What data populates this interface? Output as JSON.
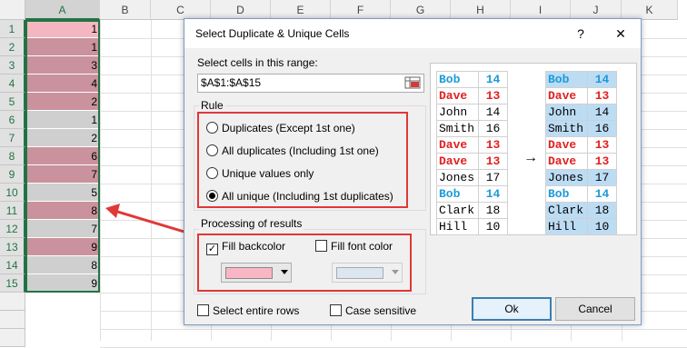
{
  "spreadsheet": {
    "columns": [
      "A",
      "B",
      "C",
      "D",
      "E",
      "F",
      "G",
      "H",
      "I",
      "J",
      "K"
    ],
    "rows": [
      {
        "num": "1",
        "value": "1",
        "highlight": "pink"
      },
      {
        "num": "2",
        "value": "1",
        "highlight": "mauve"
      },
      {
        "num": "3",
        "value": "3",
        "highlight": "mauve"
      },
      {
        "num": "4",
        "value": "4",
        "highlight": "mauve"
      },
      {
        "num": "5",
        "value": "2",
        "highlight": "mauve"
      },
      {
        "num": "6",
        "value": "1",
        "highlight": "gray"
      },
      {
        "num": "7",
        "value": "2",
        "highlight": "gray"
      },
      {
        "num": "8",
        "value": "6",
        "highlight": "mauve"
      },
      {
        "num": "9",
        "value": "7",
        "highlight": "mauve"
      },
      {
        "num": "10",
        "value": "5",
        "highlight": "gray"
      },
      {
        "num": "11",
        "value": "8",
        "highlight": "mauve"
      },
      {
        "num": "12",
        "value": "7",
        "highlight": "gray"
      },
      {
        "num": "13",
        "value": "9",
        "highlight": "mauve"
      },
      {
        "num": "14",
        "value": "8",
        "highlight": "gray"
      },
      {
        "num": "15",
        "value": "9",
        "highlight": "gray"
      }
    ],
    "colors": {
      "pink": "#f4b7c1",
      "mauve": "#c9929c",
      "gray": "#cfcfcf"
    }
  },
  "dialog": {
    "title": "Select Duplicate & Unique Cells",
    "help_label": "?",
    "close_label": "✕",
    "range_label": "Select cells in this range:",
    "range_value": "$A$1:$A$15",
    "rule_title": "Rule",
    "rules": [
      {
        "label": "Duplicates (Except 1st one)",
        "selected": false
      },
      {
        "label": "All duplicates (Including 1st one)",
        "selected": false
      },
      {
        "label": "Unique values only",
        "selected": false
      },
      {
        "label": "All unique (Including 1st duplicates)",
        "selected": true
      }
    ],
    "processing_title": "Processing of results",
    "fill_backcolor_label": "Fill backcolor",
    "fill_backcolor_checked": true,
    "fill_backcolor_color": "#f9b6c4",
    "fill_font_label": "Fill font color",
    "fill_font_checked": false,
    "fill_font_color": "#dbe6f2",
    "select_rows_label": "Select entire rows",
    "case_sensitive_label": "Case sensitive",
    "ok_label": "Ok",
    "cancel_label": "Cancel",
    "check_mark": "✓"
  },
  "preview": {
    "before": [
      {
        "name": "Bob",
        "num": "14",
        "color": "#1e9bd7"
      },
      {
        "name": "Dave",
        "num": "13",
        "color": "#e02020"
      },
      {
        "name": "John",
        "num": "14",
        "color": "#000000"
      },
      {
        "name": "Smith",
        "num": "16",
        "color": "#000000"
      },
      {
        "name": "Dave",
        "num": "13",
        "color": "#e02020"
      },
      {
        "name": "Dave",
        "num": "13",
        "color": "#e02020"
      },
      {
        "name": "Jones",
        "num": "17",
        "color": "#000000"
      },
      {
        "name": "Bob",
        "num": "14",
        "color": "#1e9bd7"
      },
      {
        "name": "Clark",
        "num": "18",
        "color": "#000000"
      },
      {
        "name": "Hill",
        "num": "10",
        "color": "#000000"
      }
    ],
    "after": [
      {
        "name": "Bob",
        "num": "14",
        "color": "#1e9bd7",
        "bg": "#bcdcf4"
      },
      {
        "name": "Dave",
        "num": "13",
        "color": "#e02020",
        "bg": "#ffffff"
      },
      {
        "name": "John",
        "num": "14",
        "color": "#000000",
        "bg": "#bcdcf4"
      },
      {
        "name": "Smith",
        "num": "16",
        "color": "#000000",
        "bg": "#bcdcf4"
      },
      {
        "name": "Dave",
        "num": "13",
        "color": "#e02020",
        "bg": "#ffffff"
      },
      {
        "name": "Dave",
        "num": "13",
        "color": "#e02020",
        "bg": "#ffffff"
      },
      {
        "name": "Jones",
        "num": "17",
        "color": "#000000",
        "bg": "#bcdcf4"
      },
      {
        "name": "Bob",
        "num": "14",
        "color": "#1e9bd7",
        "bg": "#ffffff"
      },
      {
        "name": "Clark",
        "num": "18",
        "color": "#000000",
        "bg": "#bcdcf4"
      },
      {
        "name": "Hill",
        "num": "10",
        "color": "#000000",
        "bg": "#bcdcf4"
      }
    ],
    "arrow": "→"
  }
}
